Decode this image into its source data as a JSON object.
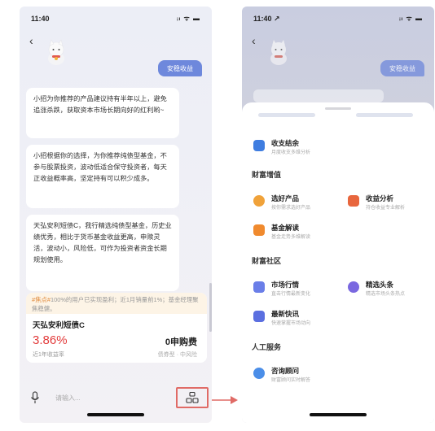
{
  "left": {
    "status_time": "11:40",
    "status_icons": "ᵢₗ ᯤ ▬",
    "back_glyph": "‹",
    "user_bubble": "安稳收益",
    "bubbles": [
      "小招为你推荐的产品建议持有半年以上，避免追涨杀跌，获取资本市场长期向好的红利哟~",
      "小招根据你的选择，为你推荐纯债型基金，不参与股票投资，波动低适合保守投资者，每天正收益概率高，坚定持有可以积少成多。",
      "天弘安利短债C，我行精选纯债型基金，历史业绩优秀，相比于货币基金收益更高，申赎灵活，波动小，风险低，可作为投资者资金长期规划使用。"
    ],
    "card": {
      "tip_tag": "#焦点#",
      "tip_text": "100%的用户已实现盈利；近1月销量前1%；基金经理聚焦稳健。",
      "name": "天弘安利短债C",
      "rate": "3.86%",
      "rate_label": "近1年收益率",
      "buy": "0申购费",
      "buy_label": "债券型 · 中风险"
    },
    "input_placeholder": "请输入...",
    "grid_glyph": "品"
  },
  "right": {
    "status_time": "11:40 ↗",
    "status_icons": "ᵢₗ ᯤ ▬",
    "back_glyph": "‹",
    "user_bubble": "安稳收益",
    "items_top": [
      {
        "title": "收支结余",
        "sub": "月度收支多维分析",
        "color": "#3f7de0"
      }
    ],
    "sections": [
      {
        "title": "财富增值",
        "items": [
          {
            "title": "选好产品",
            "sub": "按你需求选好产品",
            "color": "#f0a23a"
          },
          {
            "title": "收益分析",
            "sub": "持仓收益专业解析",
            "color": "#e8663d"
          },
          {
            "title": "基金解读",
            "sub": "基金走势多维解读",
            "color": "#f08a2e"
          }
        ]
      },
      {
        "title": "财富社区",
        "items": [
          {
            "title": "市场行情",
            "sub": "直击行情最新变化",
            "color": "#6a7ee8"
          },
          {
            "title": "精选头条",
            "sub": "精选市场头条热点",
            "color": "#7a68e0"
          },
          {
            "title": "最新快讯",
            "sub": "快速掌握市场动向",
            "color": "#5b6fe0"
          }
        ]
      },
      {
        "title": "人工服务",
        "items": [
          {
            "title": "咨询顾问",
            "sub": "财富顾问实时解答",
            "color": "#4b8ee8"
          }
        ]
      }
    ]
  },
  "colors": {
    "accent": "#6e88dc",
    "rate_red": "#e23b3b",
    "highlight_border": "#e06b66"
  }
}
